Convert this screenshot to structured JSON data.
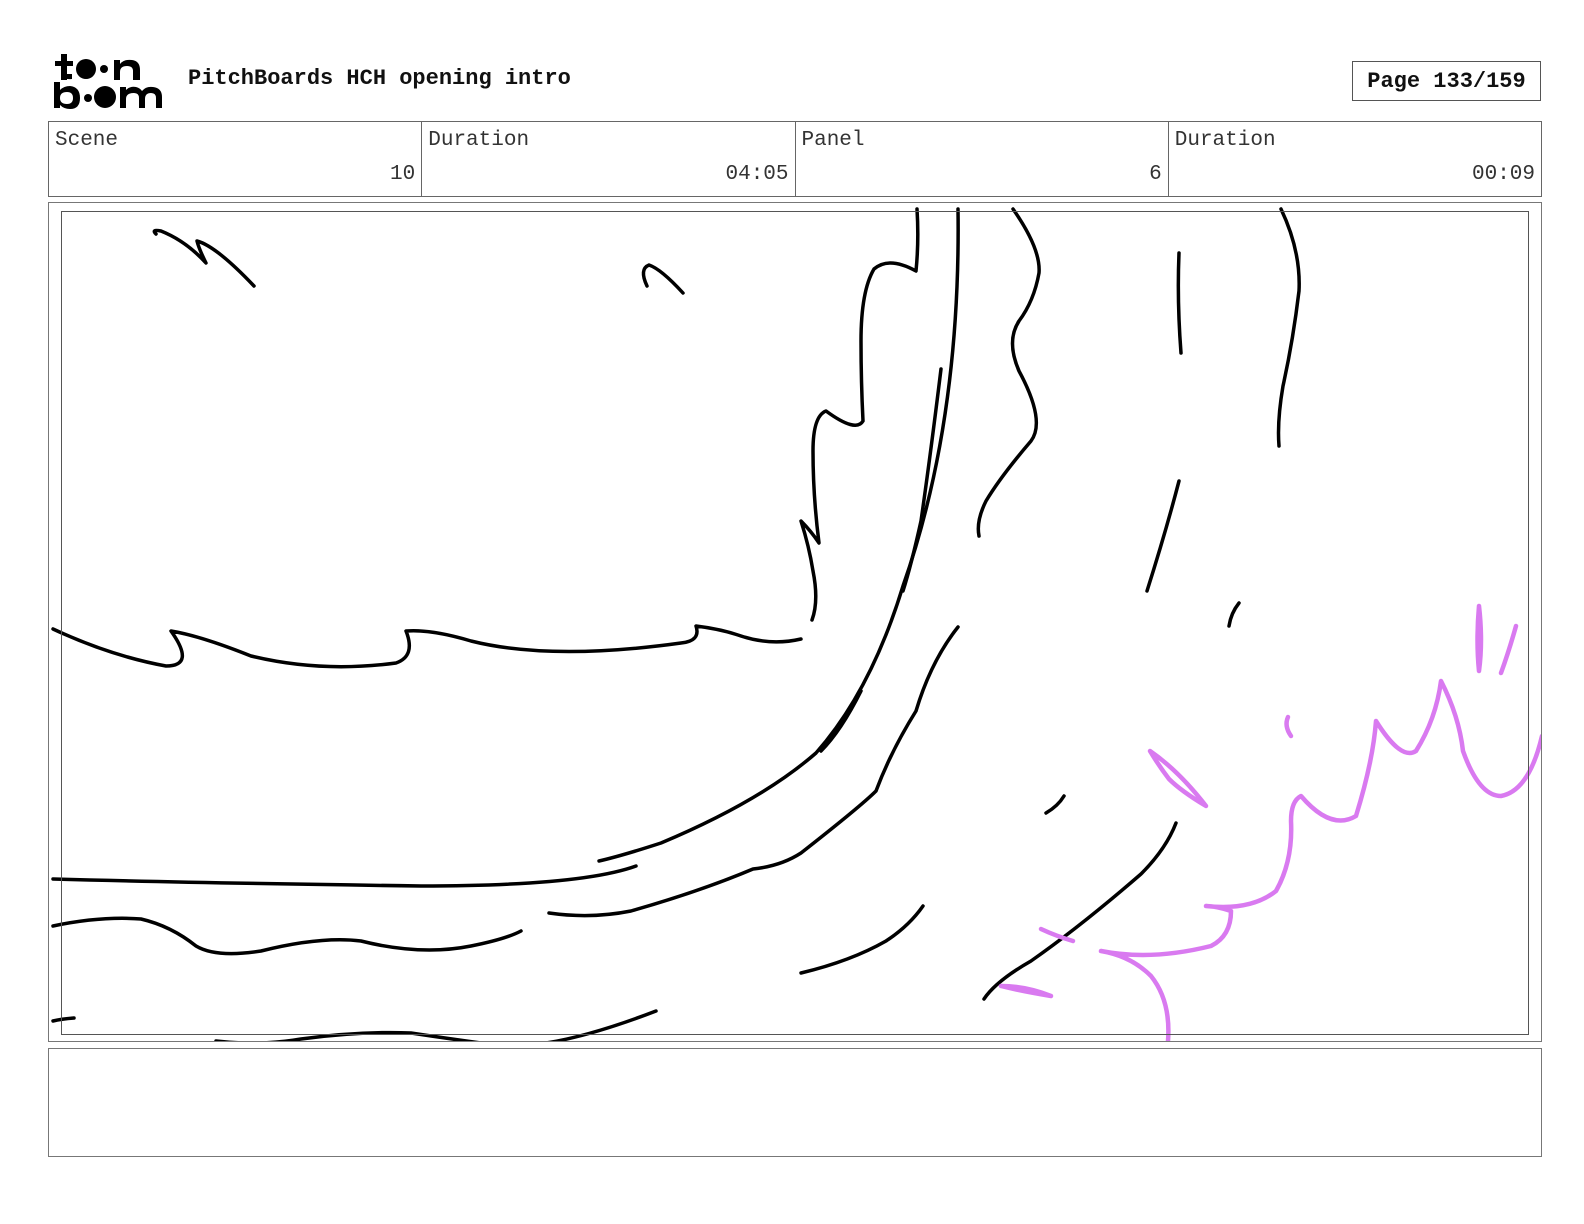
{
  "header": {
    "logo_text": "toon boom",
    "project_title": "PitchBoards HCH opening intro",
    "page_label": "Page 133/159"
  },
  "info": {
    "scene_label": "Scene",
    "scene_value": "10",
    "scene_duration_label": "Duration",
    "scene_duration_value": "04:05",
    "panel_label": "Panel",
    "panel_value": "6",
    "panel_duration_label": "Duration",
    "panel_duration_value": "00:09"
  },
  "panel": {
    "ink_color": "#000000",
    "accent_color": "#d97af0"
  },
  "notes": {
    "text": ""
  }
}
